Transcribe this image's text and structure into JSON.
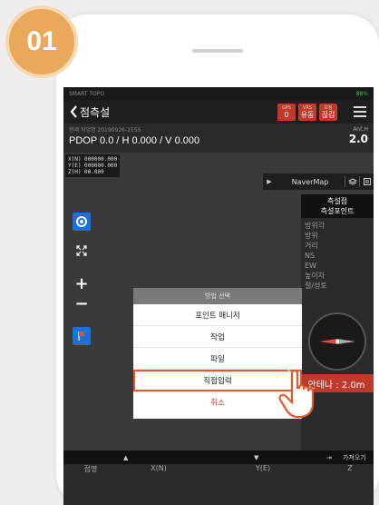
{
  "step_badge": "01",
  "status_bar": {
    "app": "SMART TOPO",
    "battery": "88%"
  },
  "title_bar": {
    "title": "점측설",
    "gnss": [
      {
        "top": "GPS",
        "bottom": "0"
      },
      {
        "top": "VRS",
        "bottom": "유동"
      },
      {
        "top": "보정",
        "bottom": "끊김"
      }
    ]
  },
  "info_bar": {
    "job_label": "현재 작업명 20190926-2155",
    "pdop": "PDOP 0.0 / H 0.000 / V 0.000",
    "anth_label": "Ant.H",
    "anth_value": "2.0"
  },
  "coords": {
    "x": "X(N) 000000.000",
    "y": "Y(E) 000000.000",
    "z": "Z(H) 00.000"
  },
  "map_bar": {
    "label": "NaverMap"
  },
  "right_panel": {
    "head1": "측설점",
    "head2": "측설포인트",
    "items": [
      "방위각",
      "방위",
      "거리",
      "NS",
      "EW",
      "높이차",
      "절/성토"
    ]
  },
  "antenna_label": "안테나 : 2.0m",
  "modal": {
    "title": "방법 선택",
    "options": [
      "포인트 매니저",
      "작업",
      "파일",
      "직접입력"
    ],
    "cancel": "취소"
  },
  "bottom_bar": {
    "capture": "가져오기"
  },
  "columns": [
    "점명",
    "X(N)",
    "Y(E)",
    "Z"
  ],
  "colors": {
    "badge": "#e9a95a",
    "accent_red": "#c0392b",
    "selection": "#e05a2b",
    "blue": "#1e6fd9"
  }
}
